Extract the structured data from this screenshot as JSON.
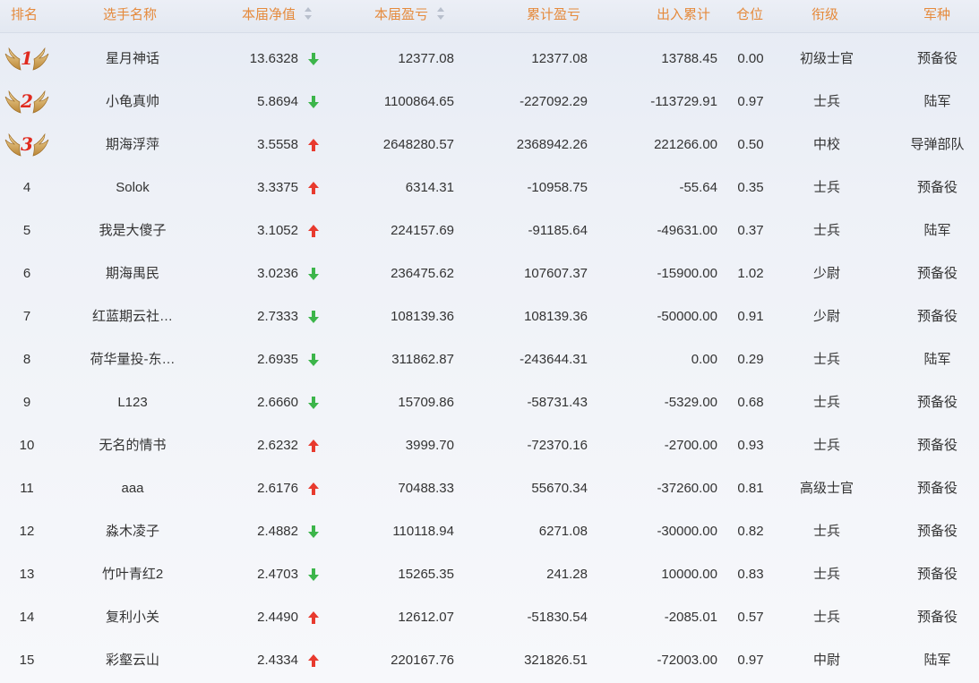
{
  "headers": {
    "rank": "排名",
    "name": "选手名称",
    "nav": "本届净值",
    "profit": "本届盈亏",
    "cum_profit": "累计盈亏",
    "in_out": "出入累计",
    "position": "仓位",
    "rank_title": "衔级",
    "branch": "军种"
  },
  "colors": {
    "header_text": "#e58a3c",
    "up_arrow": "#e83a2e",
    "down_arrow": "#3cb54a",
    "medal_number": "#e02a1f"
  },
  "rows": [
    {
      "rank": "1",
      "name": "星月神话",
      "nav": "13.6328",
      "trend": "down",
      "profit": "12377.08",
      "cum_profit": "12377.08",
      "in_out": "13788.45",
      "position": "0.00",
      "title": "初级士官",
      "branch": "预备役"
    },
    {
      "rank": "2",
      "name": "小龟真帅",
      "nav": "5.8694",
      "trend": "down",
      "profit": "1100864.65",
      "cum_profit": "-227092.29",
      "in_out": "-113729.91",
      "position": "0.97",
      "title": "士兵",
      "branch": "陆军"
    },
    {
      "rank": "3",
      "name": "期海浮萍",
      "nav": "3.5558",
      "trend": "up",
      "profit": "2648280.57",
      "cum_profit": "2368942.26",
      "in_out": "221266.00",
      "position": "0.50",
      "title": "中校",
      "branch": "导弹部队"
    },
    {
      "rank": "4",
      "name": "Solok",
      "nav": "3.3375",
      "trend": "up",
      "profit": "6314.31",
      "cum_profit": "-10958.75",
      "in_out": "-55.64",
      "position": "0.35",
      "title": "士兵",
      "branch": "预备役"
    },
    {
      "rank": "5",
      "name": "我是大傻子",
      "nav": "3.1052",
      "trend": "up",
      "profit": "224157.69",
      "cum_profit": "-91185.64",
      "in_out": "-49631.00",
      "position": "0.37",
      "title": "士兵",
      "branch": "陆军"
    },
    {
      "rank": "6",
      "name": "期海禺民",
      "nav": "3.0236",
      "trend": "down",
      "profit": "236475.62",
      "cum_profit": "107607.37",
      "in_out": "-15900.00",
      "position": "1.02",
      "title": "少尉",
      "branch": "预备役"
    },
    {
      "rank": "7",
      "name": "红蓝期云社…",
      "nav": "2.7333",
      "trend": "down",
      "profit": "108139.36",
      "cum_profit": "108139.36",
      "in_out": "-50000.00",
      "position": "0.91",
      "title": "少尉",
      "branch": "预备役"
    },
    {
      "rank": "8",
      "name": "荷华量投-东…",
      "nav": "2.6935",
      "trend": "down",
      "profit": "311862.87",
      "cum_profit": "-243644.31",
      "in_out": "0.00",
      "position": "0.29",
      "title": "士兵",
      "branch": "陆军"
    },
    {
      "rank": "9",
      "name": "L123",
      "nav": "2.6660",
      "trend": "down",
      "profit": "15709.86",
      "cum_profit": "-58731.43",
      "in_out": "-5329.00",
      "position": "0.68",
      "title": "士兵",
      "branch": "预备役"
    },
    {
      "rank": "10",
      "name": "无名的情书",
      "nav": "2.6232",
      "trend": "up",
      "profit": "3999.70",
      "cum_profit": "-72370.16",
      "in_out": "-2700.00",
      "position": "0.93",
      "title": "士兵",
      "branch": "预备役"
    },
    {
      "rank": "11",
      "name": "aaa",
      "nav": "2.6176",
      "trend": "up",
      "profit": "70488.33",
      "cum_profit": "55670.34",
      "in_out": "-37260.00",
      "position": "0.81",
      "title": "高级士官",
      "branch": "预备役"
    },
    {
      "rank": "12",
      "name": "淼木凌子",
      "nav": "2.4882",
      "trend": "down",
      "profit": "110118.94",
      "cum_profit": "6271.08",
      "in_out": "-30000.00",
      "position": "0.82",
      "title": "士兵",
      "branch": "预备役"
    },
    {
      "rank": "13",
      "name": "竹叶青红2",
      "nav": "2.4703",
      "trend": "down",
      "profit": "15265.35",
      "cum_profit": "241.28",
      "in_out": "10000.00",
      "position": "0.83",
      "title": "士兵",
      "branch": "预备役"
    },
    {
      "rank": "14",
      "name": "复利小关",
      "nav": "2.4490",
      "trend": "up",
      "profit": "12612.07",
      "cum_profit": "-51830.54",
      "in_out": "-2085.01",
      "position": "0.57",
      "title": "士兵",
      "branch": "预备役"
    },
    {
      "rank": "15",
      "name": "彩壑云山",
      "nav": "2.4334",
      "trend": "up",
      "profit": "220167.76",
      "cum_profit": "321826.51",
      "in_out": "-72003.00",
      "position": "0.97",
      "title": "中尉",
      "branch": "陆军"
    }
  ]
}
